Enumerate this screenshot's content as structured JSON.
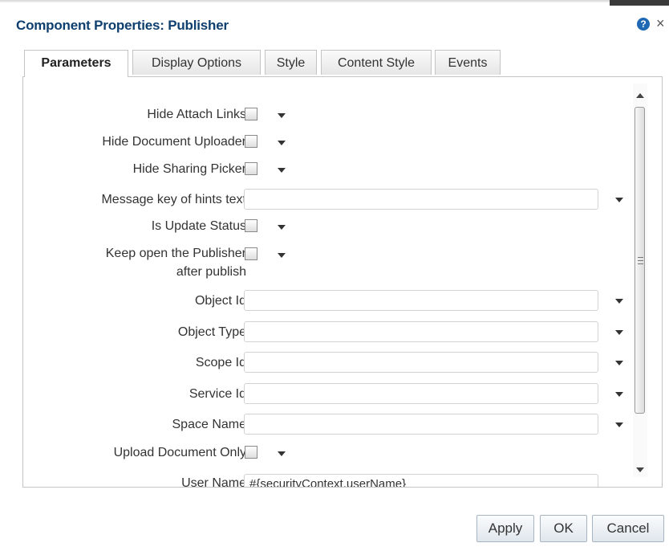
{
  "dialog": {
    "title": "Component Properties: Publisher",
    "help_icon": "?",
    "close_icon": "×"
  },
  "tabs": [
    {
      "label": "Parameters",
      "active": true
    },
    {
      "label": "Display Options",
      "active": false
    },
    {
      "label": "Style",
      "active": false
    },
    {
      "label": "Content Style",
      "active": false
    },
    {
      "label": "Events",
      "active": false
    }
  ],
  "fields": {
    "hide_attach_links": {
      "label": "Hide Attach Links",
      "checked": false
    },
    "hide_document_uploader": {
      "label": "Hide Document Uploader",
      "checked": false
    },
    "hide_sharing_picker": {
      "label": "Hide Sharing Picker",
      "checked": false
    },
    "message_key": {
      "label": "Message key of hints text",
      "value": ""
    },
    "is_update_status": {
      "label": "Is Update Status",
      "checked": false
    },
    "keep_open": {
      "label_line1": "Keep open the Publisher",
      "label_line2": "after publish",
      "checked": false
    },
    "object_id": {
      "label": "Object Id",
      "value": ""
    },
    "object_type": {
      "label": "Object Type",
      "value": ""
    },
    "scope_id": {
      "label": "Scope Id",
      "value": ""
    },
    "service_id": {
      "label": "Service Id",
      "value": ""
    },
    "space_name": {
      "label": "Space Name",
      "value": ""
    },
    "upload_document_only": {
      "label": "Upload Document Only",
      "checked": false
    },
    "user_name": {
      "label": "User Name",
      "value": "#{securityContext.userName}"
    }
  },
  "buttons": {
    "apply": "Apply",
    "ok": "OK",
    "cancel": "Cancel"
  },
  "colors": {
    "title": "#0f3f6e",
    "help_icon": "#1f68b3",
    "button_border": "#a7b4c2"
  }
}
